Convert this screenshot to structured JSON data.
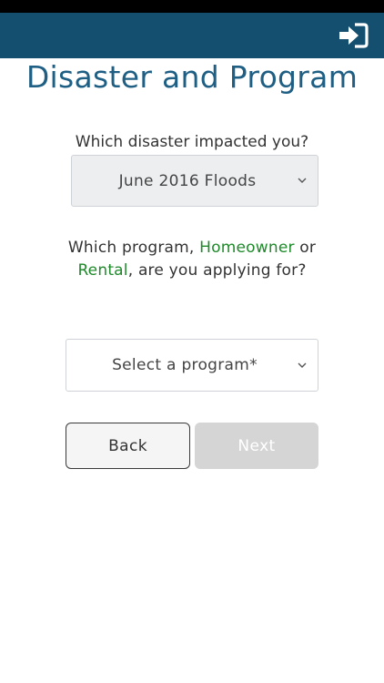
{
  "header": {
    "login_icon": "sign-in-icon",
    "background_color": "#154f6f"
  },
  "page": {
    "title": "Disaster and Program"
  },
  "disaster": {
    "question": "Which disaster impacted you?",
    "selected": "June 2016 Floods"
  },
  "program": {
    "question_prefix": "Which program,",
    "homeowner": "Homeowner",
    "or": "or",
    "rental": "Rental",
    "question_suffix": ", are you applying for?",
    "placeholder": "Select a program*",
    "accent_color": "#1e8a2a"
  },
  "actions": {
    "back_label": "Back",
    "next_label": "Next"
  }
}
